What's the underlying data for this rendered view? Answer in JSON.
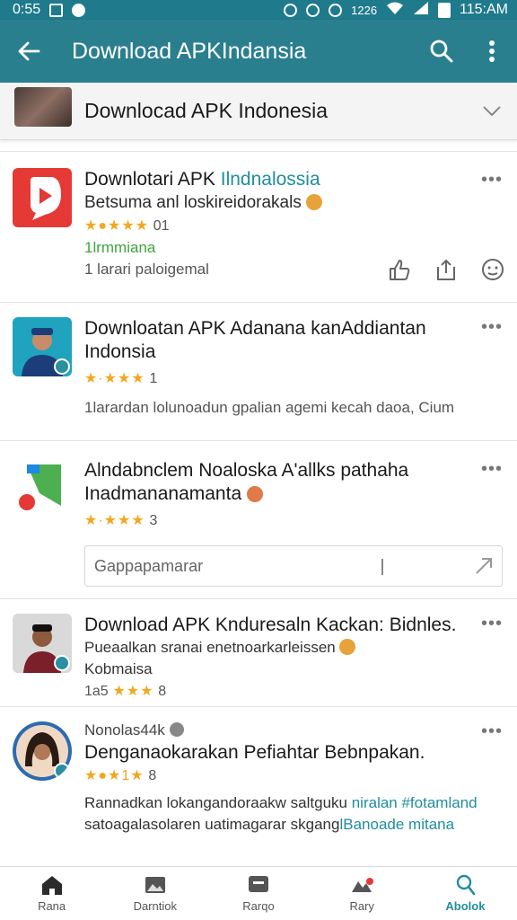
{
  "status_bar": {
    "time_left": "0:55",
    "battery_label": "1226",
    "time_right": "115:AM"
  },
  "app_bar": {
    "title": "Download APKIndansia"
  },
  "collapse_header": {
    "title": "Downlocad APK Indonesia"
  },
  "posts": [
    {
      "title_prefix": "Downlotari APK ",
      "title_accent": "Ilndnalossia",
      "subtitle": "Betsuma anl loskireidorakals",
      "rating": "01",
      "status": "1lrmmiana",
      "meta": "1 larari paloigemal"
    },
    {
      "title_line1": "Downloatan APK Adanana kanAddiantan",
      "title_line2": "Indonsia",
      "rating": "1",
      "meta": "1larardan lolunoadun gpalian agemi kecah daoa, Cium"
    },
    {
      "title_line1": "Alndabnclem Noaloska A'allks pathaha",
      "title_line2": "Inadmananamanta",
      "rating": "3",
      "comment_placeholder": "Gappapamarar"
    },
    {
      "title": "Download APK Knduresaln Kackan: Bidnles.",
      "subtitle": "Pueaalkan sranai enetnoarkarleissen",
      "subtitle2": "Kobmaisa",
      "rating_prefix": "1a5",
      "rating": "8"
    },
    {
      "author": "Nonolas44k",
      "title": "Denganaokarakan Pefiahtar Bebnpakan.",
      "rating": "8",
      "meta_line1_prefix": "Rannadkan lokangandoraakw saltguku",
      "meta_line1_accent": "niralan #fotamland",
      "meta_line2_prefix": "satoagalasolaren uatimagarar skgang",
      "meta_line2_accent": "lBanoade mitana"
    }
  ],
  "bottom_nav": [
    {
      "label": "Rana",
      "icon": "home-icon"
    },
    {
      "label": "Darntiok",
      "icon": "gallery-icon"
    },
    {
      "label": "Rarqo",
      "icon": "chat-icon"
    },
    {
      "label": "Rary",
      "icon": "photo-icon"
    },
    {
      "label": "Abolok",
      "icon": "profile-icon"
    }
  ],
  "colors": {
    "app_bar": "#2a7f8f",
    "accent": "#1f8e9e",
    "star": "#f2a81d",
    "green": "#3fa53f"
  }
}
